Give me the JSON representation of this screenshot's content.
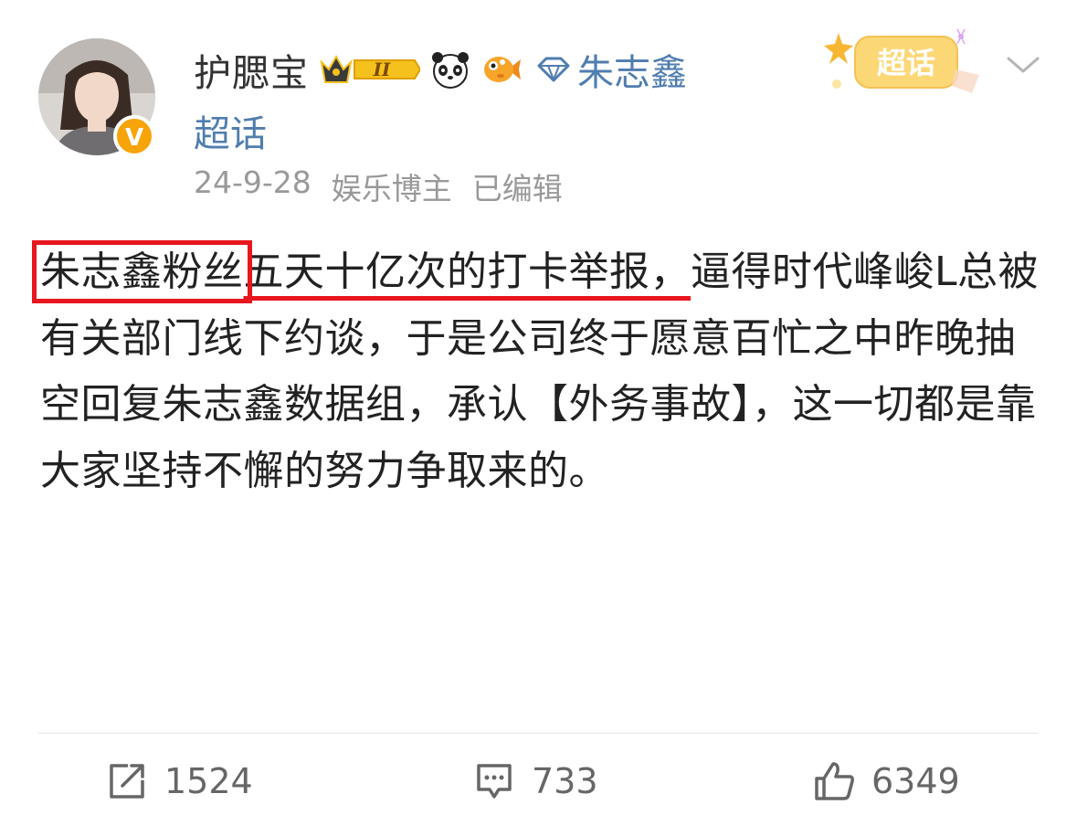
{
  "user": {
    "name": "护腮宝",
    "vip_level": "II"
  },
  "topic": {
    "name": "朱志鑫",
    "suffix": "超话"
  },
  "super_topic_badge": "超话",
  "meta": {
    "date": "24-9-28",
    "role": "娱乐博主",
    "edited": "已编辑"
  },
  "post": {
    "highlight_box": "朱志鑫粉丝",
    "highlight_underline": "五天十亿次的打卡举报，",
    "rest": "逼得时代峰峻L总被有关部门线下约谈，于是公司终于愿意百忙之中昨晚抽空回复朱志鑫数据组，承认【外务事故】，这一切都是靠大家坚持不懈的努力争取来的。"
  },
  "actions": {
    "reposts": "1524",
    "comments": "733",
    "likes": "6349"
  },
  "colors": {
    "link": "#507daf",
    "highlight": "#e8161e",
    "verified": "#f7a40a",
    "meta": "#999999"
  }
}
